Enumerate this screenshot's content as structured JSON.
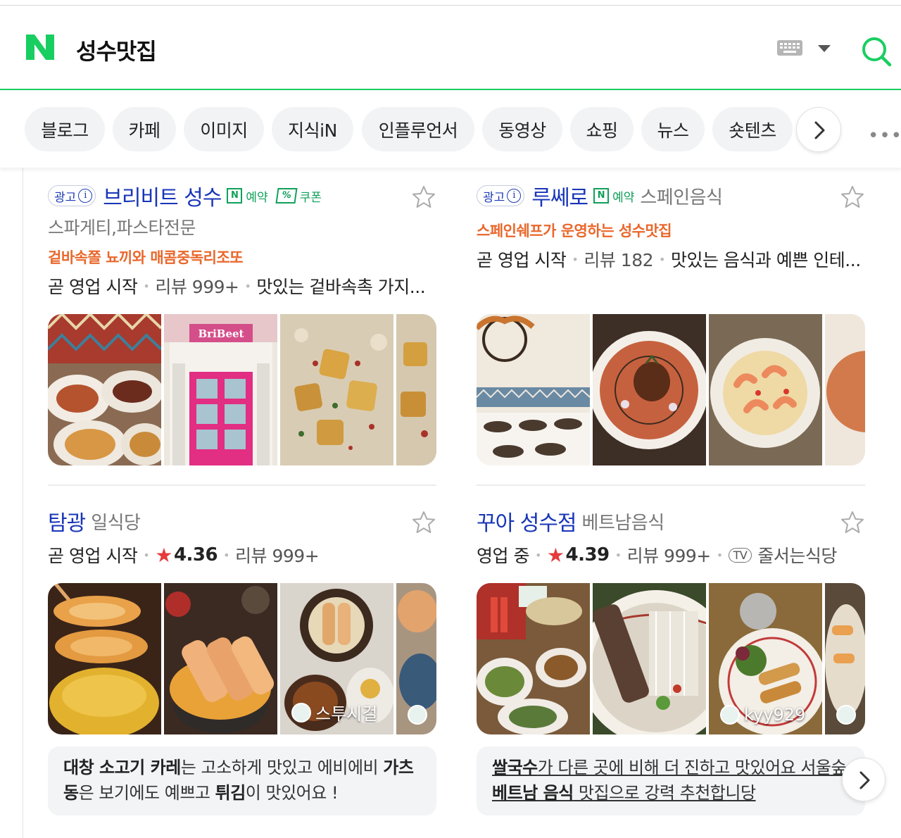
{
  "search": {
    "query": "성수맛집",
    "logo_letter": "N"
  },
  "icons": {
    "logo": "naver-logo-icon",
    "keyboard": "keyboard-icon",
    "dropdown": "caret-down-icon",
    "search": "search-icon",
    "next": "chevron-right-icon",
    "more": "more-dots-icon",
    "bookmark": "star-outline-icon"
  },
  "tabs": [
    "블로그",
    "카페",
    "이미지",
    "지식iN",
    "인플루언서",
    "동영상",
    "쇼핑",
    "뉴스",
    "숏텐츠"
  ],
  "more_label": "•••",
  "colors": {
    "brand": "#19ce60",
    "link": "#1836b8",
    "promo": "#e9672b",
    "star": "#e53b3b"
  },
  "results": [
    {
      "ad_label": "광고",
      "ad_info": "i",
      "name": "브리비트 성수",
      "badge": "예약",
      "coupon": "쿠폰",
      "subtitle": "스파게티,파스타전문",
      "promo": "겉바속쫄 뇨끼와 매콤중독리조또",
      "status": "곧 영업 시작",
      "review_count": "리뷰 999+",
      "snippet": "맛있는 겉바속촉 가지..."
    },
    {
      "ad_label": "광고",
      "ad_info": "i",
      "name": "루쎄로",
      "badge": "예약",
      "category": "스페인음식",
      "promo": "스페인쉐프가 운영하는 성수맛집",
      "status": "곧 영업 시작",
      "review_count": "리뷰 182",
      "snippet": "맛있는 음식과 예쁜 인테..."
    },
    {
      "name": "탐광",
      "category": "일식당",
      "status": "곧 영업 시작",
      "rating": "4.36",
      "review_count": "리뷰 999+",
      "photo_user": "스투시걸",
      "review_parts": [
        {
          "t": "대창 소고기 카레",
          "b": true
        },
        {
          "t": "는 고소하게 맛있고 에비에비 ",
          "b": false
        },
        {
          "t": "가츠동",
          "b": true
        },
        {
          "t": "은 보기에도 예쁘고 ",
          "b": false
        },
        {
          "t": "튀김",
          "b": true
        },
        {
          "t": "이 맛있어요 !",
          "b": false
        }
      ]
    },
    {
      "name": "꾸아 성수점",
      "category": "베트남음식",
      "status": "영업 중",
      "rating": "4.39",
      "review_count": "리뷰 999+",
      "tv_label": "TV",
      "tv_show": "줄서는식당",
      "photo_user": "kyy929",
      "review_parts": [
        {
          "t": "쌀국수",
          "b": true
        },
        {
          "t": "가 다른 곳에 비해 더 진하고 맛있어요 서울숲 ",
          "b": false
        },
        {
          "t": "베트남 음식",
          "b": true
        },
        {
          "t": " 맛집으로 강력 추천합니당",
          "b": false
        }
      ]
    }
  ]
}
